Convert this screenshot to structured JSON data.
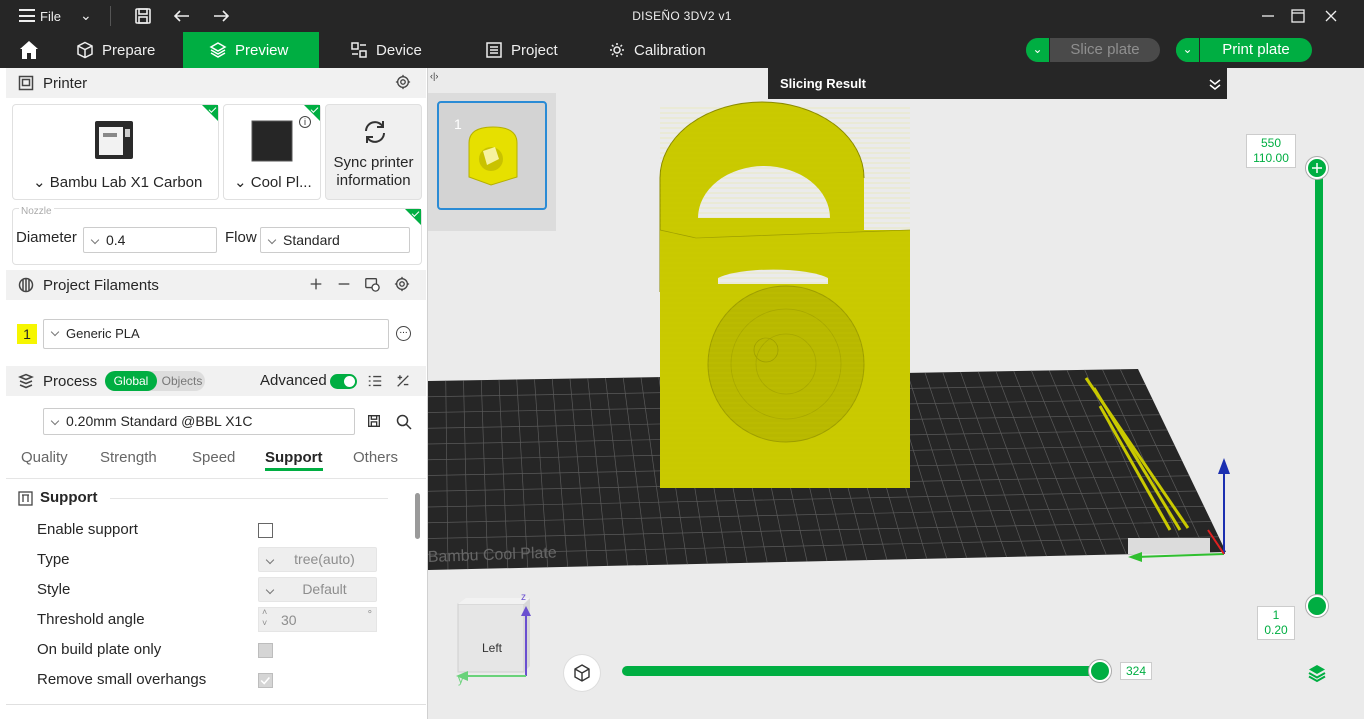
{
  "window": {
    "title": "DISEÑO 3DV2 v1",
    "file_menu": "File"
  },
  "nav": {
    "tabs": [
      {
        "label": "Prepare",
        "icon": "cube-icon"
      },
      {
        "label": "Preview",
        "icon": "layers-icon",
        "active": true
      },
      {
        "label": "Device",
        "icon": "device-icon"
      },
      {
        "label": "Project",
        "icon": "project-icon"
      },
      {
        "label": "Calibration",
        "icon": "calibration-icon"
      }
    ],
    "slice_label": "Slice plate",
    "print_label": "Print plate"
  },
  "printer": {
    "header": "Printer",
    "model": "Bambu Lab X1 Carbon",
    "plate": "Cool Pl...",
    "sync_line1": "Sync printer",
    "sync_line2": "information",
    "nozzle_label": "Nozzle",
    "diameter_label": "Diameter",
    "diameter_value": "0.4",
    "flow_label": "Flow",
    "flow_value": "Standard"
  },
  "filaments": {
    "header": "Project Filaments",
    "items": [
      {
        "index": "1",
        "name": "Generic PLA",
        "color": "#f6f600"
      }
    ]
  },
  "process": {
    "header": "Process",
    "toggle_global": "Global",
    "toggle_objects": "Objects",
    "advanced_label": "Advanced",
    "advanced_on": true,
    "preset": "0.20mm Standard @BBL X1C",
    "tabs": [
      "Quality",
      "Strength",
      "Speed",
      "Support",
      "Others"
    ],
    "active_tab": "Support",
    "section_title": "Support",
    "settings": [
      {
        "label": "Enable support",
        "kind": "checkbox",
        "checked": false
      },
      {
        "label": "Type",
        "kind": "select",
        "value": "tree(auto)"
      },
      {
        "label": "Style",
        "kind": "select",
        "value": "Default"
      },
      {
        "label": "Threshold angle",
        "kind": "spin",
        "value": "30",
        "unit": "°"
      },
      {
        "label": "On build plate only",
        "kind": "checkbox",
        "checked": false,
        "disabled": true
      },
      {
        "label": "Remove small overhangs",
        "kind": "checkbox",
        "checked": true,
        "disabled": true
      }
    ]
  },
  "viewport": {
    "slicing_result": "Slicing Result",
    "plate_number": "1",
    "plate_text": "Bambu Cool Plate",
    "layer_top_count": "550",
    "layer_top_height": "110.00",
    "layer_bottom_count": "1",
    "layer_bottom_height": "0.20",
    "move_value": "324",
    "view_cube_label": "Left",
    "axis_z": "z",
    "axis_y": "y",
    "model_color": "#c9c900"
  },
  "colors": {
    "accent": "#00ae42",
    "titlebar": "#262626"
  }
}
